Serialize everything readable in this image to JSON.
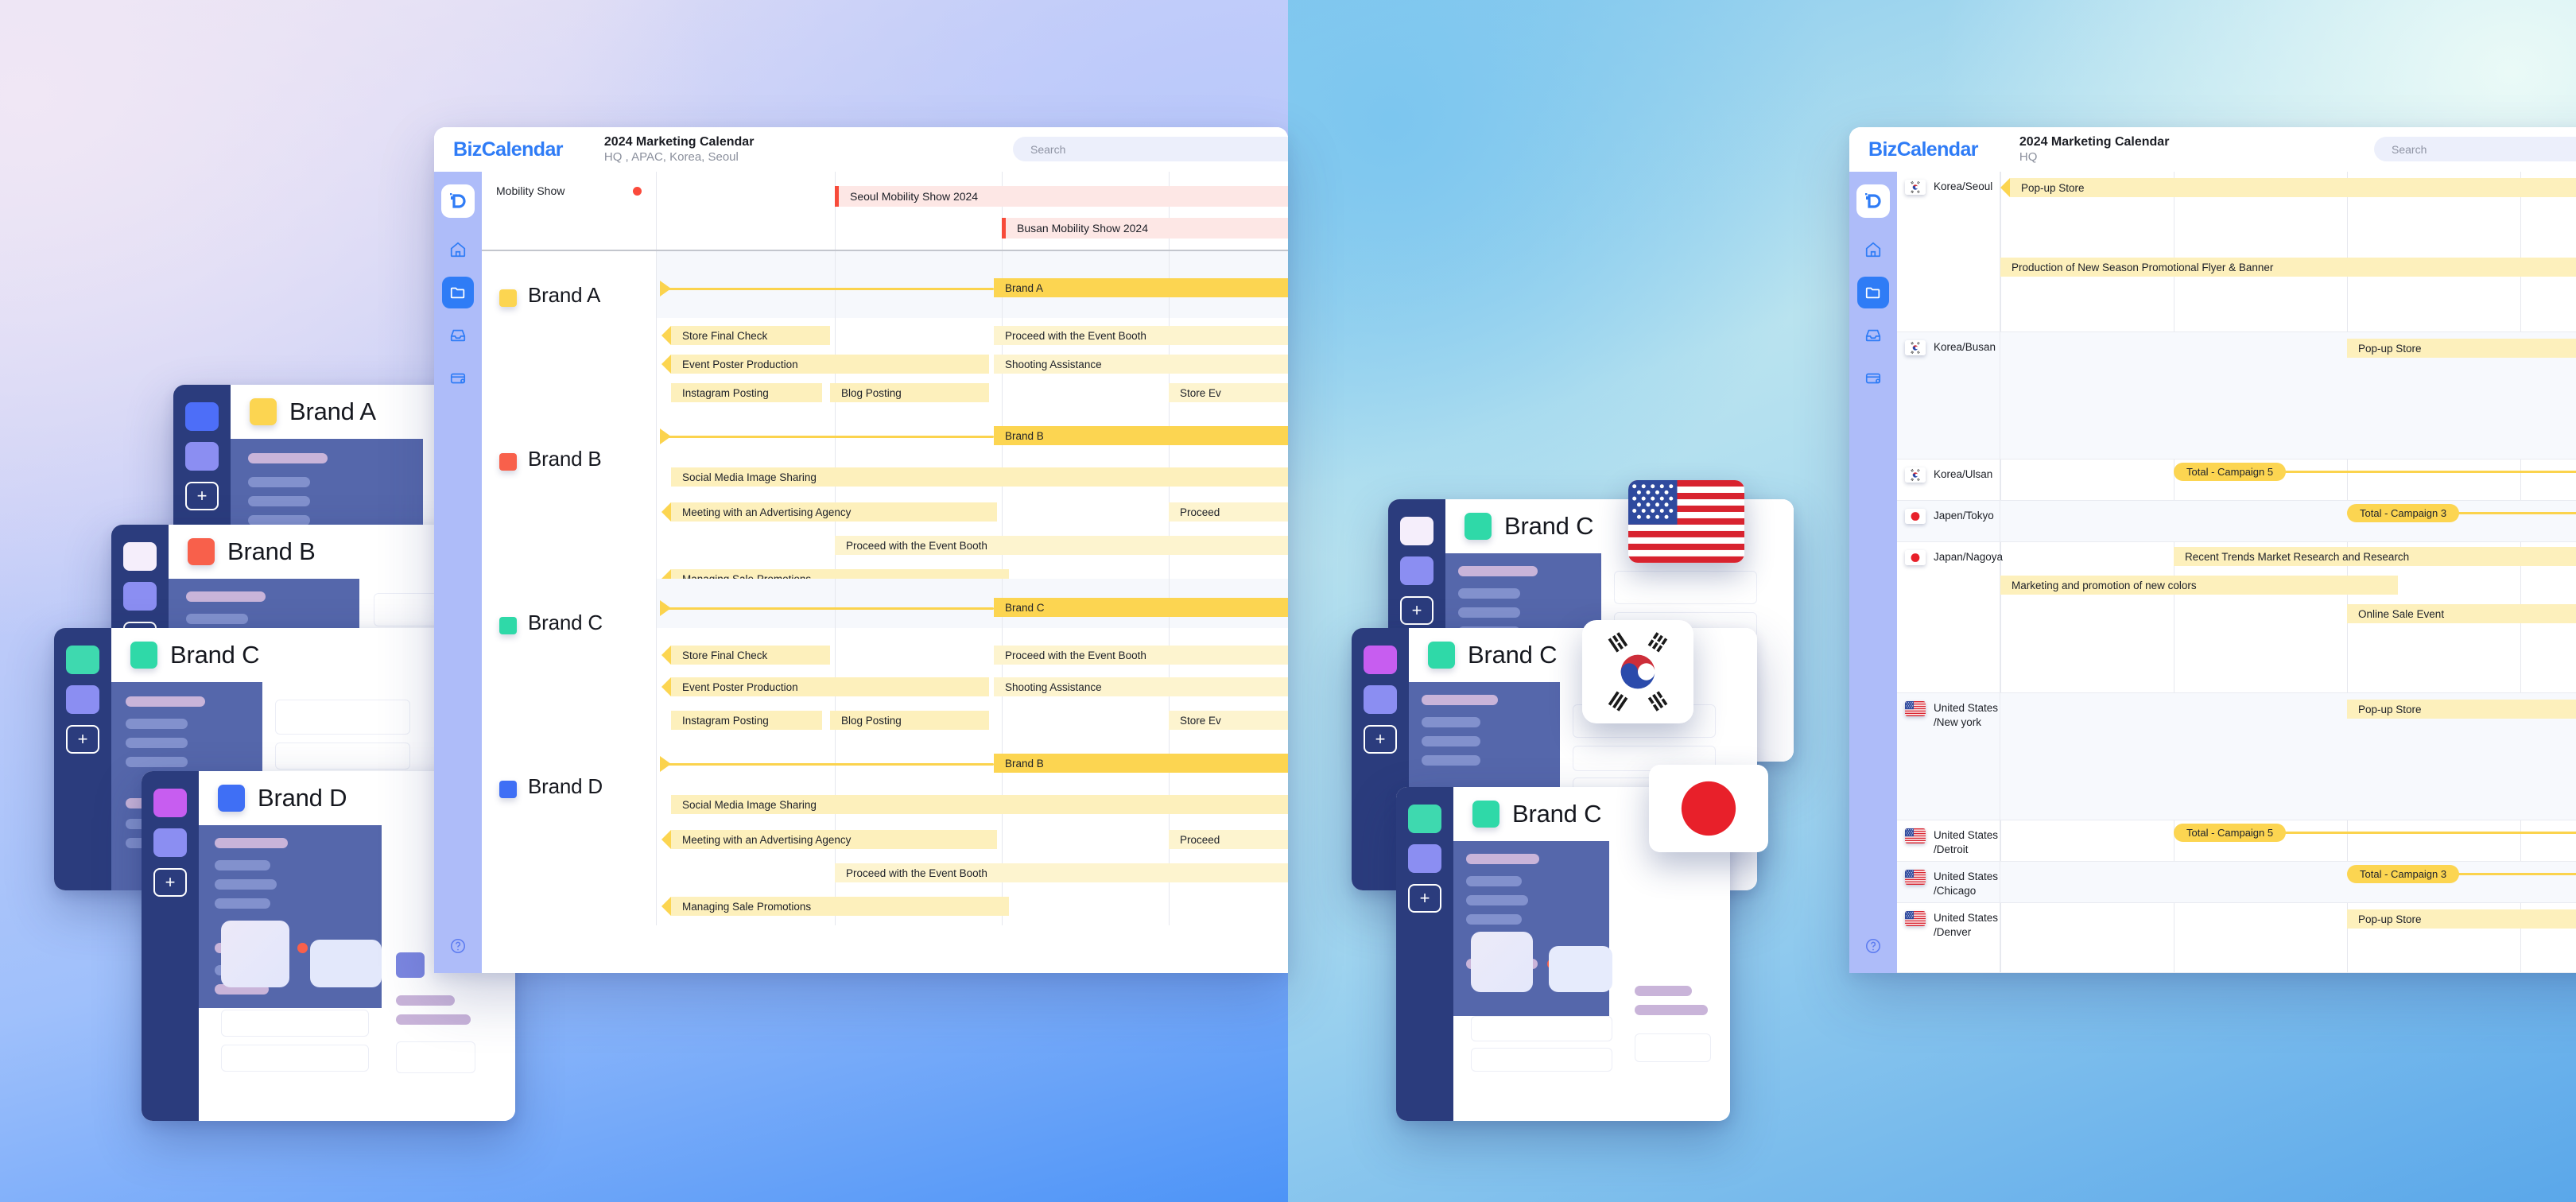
{
  "background": {
    "left_gradient": "#e7e2f4 → #4d94f7",
    "right_gradient": "#87c9ee → #5aa7ea"
  },
  "app": {
    "logo": "BizCalendar",
    "search_placeholder": "Search",
    "rail_icons": [
      "logo-icon",
      "home-icon",
      "folder-icon",
      "inbox-icon",
      "card-icon",
      "help-icon"
    ]
  },
  "left_window": {
    "title": "2024 Marketing Calendar",
    "subtitle": "HQ , APAC, Korea, Seoul",
    "header_row": {
      "label": "Mobility Show",
      "events": [
        {
          "label": "Seoul Mobility Show 2024"
        },
        {
          "label": "Busan Mobility Show 2024"
        }
      ]
    },
    "brands": [
      {
        "name": "Brand A",
        "color": "#fcd551",
        "milestone": "Brand A",
        "tasks": [
          {
            "label": "Store Final Check"
          },
          {
            "label": "Proceed with the Event Booth"
          },
          {
            "label": "Event Poster Production"
          },
          {
            "label": "Shooting Assistance"
          },
          {
            "label": "Instagram Posting"
          },
          {
            "label": "Blog Posting"
          },
          {
            "label": "Store Ev"
          }
        ]
      },
      {
        "name": "Brand B",
        "color": "#f8604b",
        "milestone": "Brand B",
        "tasks": [
          {
            "label": "Social Media Image Sharing"
          },
          {
            "label": "Meeting with an Advertising Agency"
          },
          {
            "label": "Proceed"
          },
          {
            "label": "Proceed with the Event Booth"
          },
          {
            "label": "Managing Sale Promotions"
          }
        ]
      },
      {
        "name": "Brand C",
        "color": "#2fd9a8",
        "milestone": "Brand C",
        "tasks": [
          {
            "label": "Store Final Check"
          },
          {
            "label": "Proceed with the Event Booth"
          },
          {
            "label": "Event Poster Production"
          },
          {
            "label": "Shooting Assistance"
          },
          {
            "label": "Instagram Posting"
          },
          {
            "label": "Blog Posting"
          },
          {
            "label": "Store Ev"
          }
        ]
      },
      {
        "name": "Brand D",
        "color": "#3f6ff5",
        "milestone": "Brand B",
        "tasks": [
          {
            "label": "Social Media Image Sharing"
          },
          {
            "label": "Meeting with an Advertising Agency"
          },
          {
            "label": "Proceed"
          },
          {
            "label": "Proceed with the Event Booth"
          },
          {
            "label": "Managing Sale Promotions"
          }
        ]
      }
    ]
  },
  "right_window": {
    "title": "2024 Marketing Calendar",
    "subtitle": "HQ",
    "rows": [
      {
        "name": "Korea/Seoul",
        "flag": "kr",
        "bars": [
          {
            "label": "Pop-up Store"
          },
          {
            "label": "Production of New Season Promotional Flyer & Banner"
          }
        ],
        "pills": []
      },
      {
        "name": "Korea/Busan",
        "flag": "kr",
        "bars": [
          {
            "label": "Pop-up Store"
          }
        ],
        "pills": []
      },
      {
        "name": "Korea/Ulsan",
        "flag": "kr",
        "bars": [],
        "pills": [
          {
            "label": "Total - Campaign 5"
          }
        ]
      },
      {
        "name": "Japen/Tokyo",
        "flag": "jp",
        "bars": [],
        "pills": [
          {
            "label": "Total - Campaign 3"
          }
        ]
      },
      {
        "name": "Japan/Nagoya",
        "flag": "jp",
        "bars": [
          {
            "label": "Recent Trends Market Research and Research"
          },
          {
            "label": "Marketing and promotion of new colors"
          },
          {
            "label": "Online Sale Event"
          }
        ],
        "pills": []
      },
      {
        "name": "United States\n/New york",
        "flag": "us",
        "bars": [
          {
            "label": "Pop-up Store"
          }
        ],
        "pills": []
      },
      {
        "name": "United States\n/Detroit",
        "flag": "us",
        "bars": [],
        "pills": [
          {
            "label": "Total - Campaign 5"
          }
        ]
      },
      {
        "name": "United States\n/Chicago",
        "flag": "us",
        "bars": [],
        "pills": [
          {
            "label": "Total - Campaign 3"
          }
        ]
      },
      {
        "name": "United States\n/Denver",
        "flag": "us",
        "bars": [
          {
            "label": "Pop-up Store"
          }
        ],
        "pills": []
      }
    ]
  },
  "mini_cards": {
    "left_stack": [
      {
        "name": "Brand A",
        "color": "#fcd551",
        "rail": [
          "#4d6ef8",
          "#8b8ef2"
        ]
      },
      {
        "name": "Brand B",
        "color": "#f8604b",
        "rail": [
          "#f5eefb",
          "#8b8ef2"
        ]
      },
      {
        "name": "Brand C",
        "color": "#2fd9a8",
        "rail": [
          "#3ed9af",
          "#8b8ef2"
        ]
      },
      {
        "name": "Brand D",
        "color": "#3f6ff5",
        "rail": [
          "#c濃",
          "#8b8ef2"
        ]
      }
    ],
    "right_stack": [
      {
        "name": "Brand C",
        "color": "#2fd9a8",
        "rail": [
          "#f5eefb",
          "#8b8ef2"
        ]
      },
      {
        "name": "Brand C",
        "color": "#2fd9a8",
        "rail": [
          "#c75df0",
          "#8b8ef2"
        ]
      },
      {
        "name": "Brand C",
        "color": "#2fd9a8",
        "rail": [
          "#3ed9af",
          "#8b8ef2"
        ]
      }
    ],
    "plus_label": "+"
  },
  "floating_flags": [
    {
      "flag": "us"
    },
    {
      "flag": "kr"
    },
    {
      "flag": "jp"
    }
  ]
}
